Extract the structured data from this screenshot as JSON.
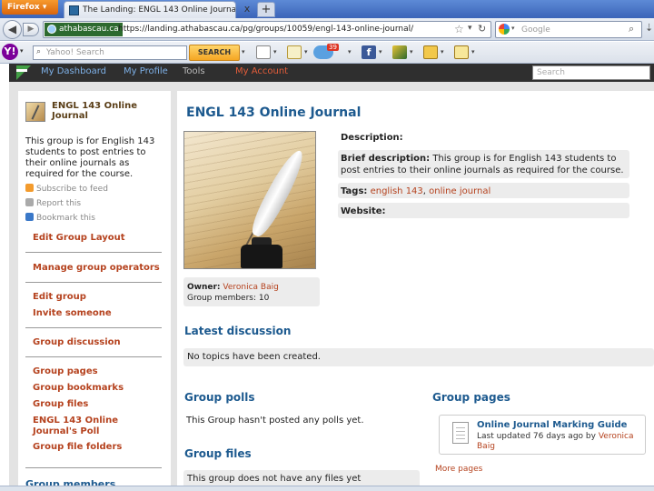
{
  "browser": {
    "menu_button": "Firefox",
    "tab_title": "The Landing: ENGL 143 Online Journal",
    "tab_close": "x",
    "new_tab": "+",
    "identity": "athabascau.ca",
    "url": "https://landing.athabascau.ca/pg/groups/10059/engl-143-online-journal/",
    "search_placeholder": "Google"
  },
  "yahoo_toolbar": {
    "search_placeholder": "Yahoo! Search",
    "search_button": "SEARCH",
    "mail_badge": "39"
  },
  "site_header": {
    "links": [
      "My Dashboard",
      "My Profile",
      "Tools",
      "My Account"
    ],
    "search_placeholder": "Search"
  },
  "sidebar": {
    "group_title": "ENGL 143 Online Journal",
    "description": "This group is for English 143 students to post entries to their online journals as required for the course.",
    "subscribe": "Subscribe to feed",
    "report": "Report this",
    "bookmark": "Bookmark this",
    "edit_layout": "Edit Group Layout",
    "manage_operators": "Manage group operators",
    "edit_group": "Edit group",
    "invite": "Invite someone",
    "discussion": "Group discussion",
    "pages": "Group pages",
    "bookmarks": "Group bookmarks",
    "files": "Group files",
    "poll_line1": "ENGL 143 Online",
    "poll_line2": "Journal's Poll",
    "file_folders": "Group file folders",
    "members_heading": "Group members"
  },
  "main": {
    "title": "ENGL 143 Online Journal",
    "owner_label": "Owner:",
    "owner_name": "Veronica Baig",
    "members_label": "Group members:",
    "members_count": "10",
    "description_label": "Description:",
    "brief_label": "Brief description:",
    "brief_text": "This group is for English 143 students to post entries to their online journals as required for the course.",
    "tags_label": "Tags:",
    "tag1": "english 143",
    "tag_sep": ",",
    "tag2": "online journal",
    "website_label": "Website:",
    "latest_heading": "Latest discussion",
    "latest_empty": "No topics have been created.",
    "polls_heading": "Group polls",
    "polls_empty": "This Group hasn't posted any polls yet.",
    "files_heading": "Group files",
    "files_empty": "This group does not have any files yet",
    "pages_heading": "Group pages",
    "page_title": "Online Journal Marking Guide",
    "page_updated": "Last updated 76 days ago by",
    "page_author": "Veronica Baig",
    "more_pages": "More pages"
  }
}
